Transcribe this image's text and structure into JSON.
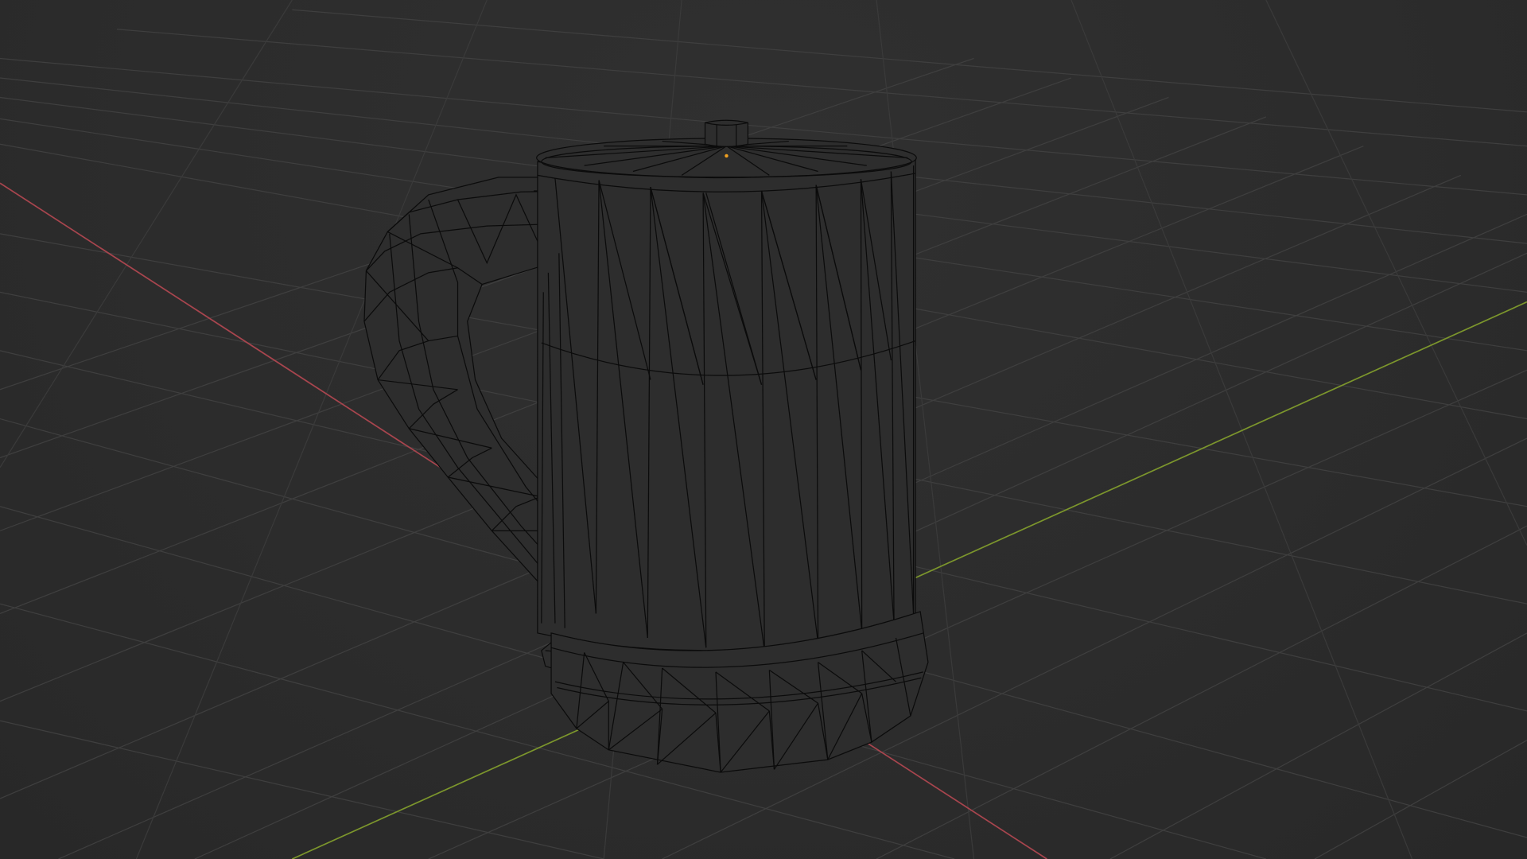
{
  "viewport": {
    "mode": "wireframe",
    "object": "mug",
    "grid": "on",
    "colors": {
      "background": "#2b2b2b",
      "grid_line": "#3f3f3f",
      "x_axis": "#a8454e",
      "y_axis": "#7c962c",
      "wire": "#0b0b0b",
      "mesh_fill": "#2d2d2d",
      "origin_point": "#f0a020"
    }
  }
}
